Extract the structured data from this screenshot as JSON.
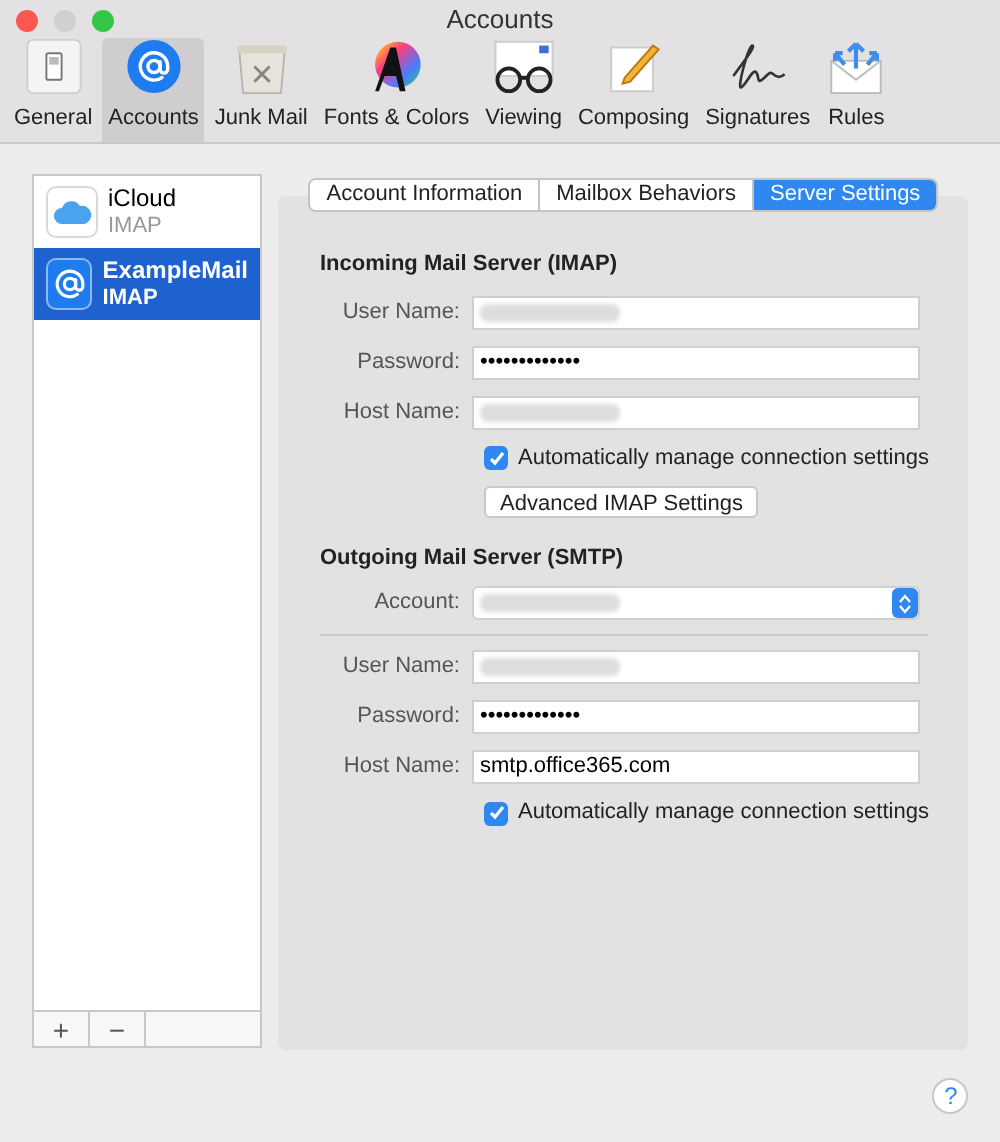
{
  "window": {
    "title": "Accounts"
  },
  "toolbar": [
    {
      "label": "General",
      "kind": "general",
      "selected": false
    },
    {
      "label": "Accounts",
      "kind": "accounts",
      "selected": true
    },
    {
      "label": "Junk Mail",
      "kind": "junk",
      "selected": false
    },
    {
      "label": "Fonts & Colors",
      "kind": "fonts",
      "selected": false
    },
    {
      "label": "Viewing",
      "kind": "viewing",
      "selected": false
    },
    {
      "label": "Composing",
      "kind": "composing",
      "selected": false
    },
    {
      "label": "Signatures",
      "kind": "signatures",
      "selected": false
    },
    {
      "label": "Rules",
      "kind": "rules",
      "selected": false
    }
  ],
  "accounts": [
    {
      "name": "iCloud",
      "type": "IMAP",
      "kind": "cloud",
      "selected": false
    },
    {
      "name": "ExampleMail",
      "type": "IMAP",
      "kind": "at",
      "selected": true
    }
  ],
  "list_buttons": [
    "+",
    "−"
  ],
  "tabs": [
    {
      "label": "Account Information",
      "selected": false
    },
    {
      "label": "Mailbox Behaviors",
      "selected": false
    },
    {
      "label": "Server Settings",
      "selected": true
    }
  ],
  "incoming": {
    "title": "Incoming Mail Server (IMAP)",
    "fields": [
      {
        "label": "User Name:",
        "kind": "redacted"
      },
      {
        "label": "Password:",
        "kind": "text",
        "value": "•••••••••••••"
      },
      {
        "label": "Host Name:",
        "kind": "redacted"
      }
    ],
    "auto_manage": {
      "label": "Automatically manage connection settings",
      "checked": true
    },
    "advanced_button": "Advanced IMAP Settings"
  },
  "outgoing": {
    "title": "Outgoing Mail Server (SMTP)",
    "account": {
      "label": "Account:"
    },
    "fields": [
      {
        "label": "User Name:",
        "kind": "redacted"
      },
      {
        "label": "Password:",
        "kind": "text",
        "value": "•••••••••••••"
      },
      {
        "label": "Host Name:",
        "kind": "text",
        "value": "smtp.office365.com"
      }
    ],
    "auto_manage": {
      "label": "Automatically manage connection settings",
      "checked": true
    }
  },
  "help": "?"
}
